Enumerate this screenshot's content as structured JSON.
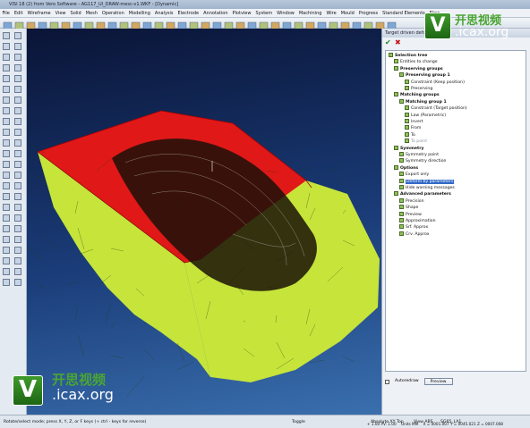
{
  "window": {
    "title": "VISI 18 (2) from Vero Software - AG117_UI_DRAW-mesc-v1.WKF - [Dynamic]"
  },
  "menu": [
    "File",
    "Edit",
    "Wireframe",
    "View",
    "Solid",
    "Mesh",
    "Operation",
    "Modelling",
    "Analysis",
    "Electrode",
    "Annotation",
    "Plotview",
    "System",
    "Window",
    "Machining",
    "Wire",
    "Mould",
    "Progress",
    "Standard Elements",
    "Flow"
  ],
  "panel": {
    "title": "Target driven deformation",
    "tree": [
      {
        "label": "Selection tree",
        "bold": true
      },
      {
        "label": "Entities to change"
      },
      {
        "label": "Preserving groups",
        "bold": true
      },
      {
        "label": "Preserving group 1",
        "bold": true
      },
      {
        "label": "Constraint (Keep position)"
      },
      {
        "label": "Preserving"
      },
      {
        "label": "Matching groups",
        "bold": true
      },
      {
        "label": "Matching group 1",
        "bold": true
      },
      {
        "label": "Constraint (Target position)"
      },
      {
        "label": "Law (Parametric)"
      },
      {
        "label": "Invert"
      },
      {
        "label": "From"
      },
      {
        "label": "To"
      },
      {
        "label": "To point"
      },
      {
        "label": "Symmetry",
        "bold": true
      },
      {
        "label": "Symmetry point"
      },
      {
        "label": "Symmetry direction"
      },
      {
        "label": "Options",
        "bold": true
      },
      {
        "label": "Export only"
      },
      {
        "label": "Deform by parameters",
        "selected": true
      },
      {
        "label": "Hide warning messages"
      },
      {
        "label": "Advanced parameters",
        "bold": true
      },
      {
        "label": "Precision"
      },
      {
        "label": "Shape"
      },
      {
        "label": "Preview"
      },
      {
        "label": "Approximation"
      },
      {
        "label": "Srf. Approx"
      },
      {
        "label": "Crv. Approx"
      }
    ],
    "autoredraw_label": "Autoredraw",
    "preview_label": "Preview"
  },
  "status": {
    "hint": "Rotate/select mode; press X, Y, Z, or F keys (+ ctrl - keys for reverse)",
    "toggle": "Toggle",
    "absolute": "Absolute XY Top",
    "view": "View ABS",
    "layer": "SG65_LA1",
    "scale": "+ 1.00 PV: 1.00",
    "unit": "Units MM",
    "coords": "X = 0001.007 Y = 0045.021 Z = 0007.008"
  },
  "watermark": {
    "cn": "开思视频",
    "en": ".icax.org",
    "letter": "V"
  },
  "colors": {
    "surface_red": "#e01818",
    "surface_yellow": "#c6e43a",
    "viewport_top": "#0a1436",
    "viewport_bottom": "#3a6fae"
  }
}
